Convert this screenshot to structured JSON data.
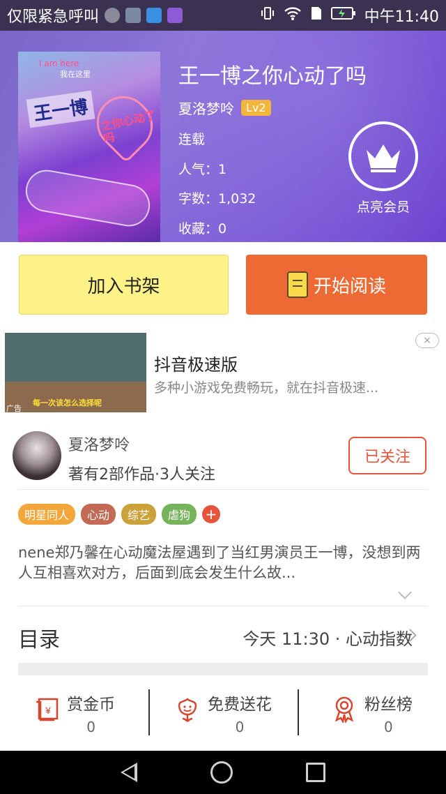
{
  "status_bar": {
    "carrier": "仅限紧急呼叫",
    "time": "中午11:40"
  },
  "book": {
    "title": "王一博之你心动了吗",
    "author": "夏洛梦呤",
    "level": "Lv2",
    "status": "连载",
    "popularity": "人气：1",
    "word_count": "字数：1,032",
    "favorites": "收藏：0",
    "vip_label": "点亮会员",
    "cover_text": {
      "tag": "I am here",
      "tag2": "我在这里",
      "title": "王一博",
      "sub": "之你心动了吗"
    }
  },
  "actions": {
    "add_shelf": "加入书架",
    "start_reading": "开始阅读"
  },
  "ad": {
    "title": "抖音极速版",
    "description": "多种小游戏免费畅玩，就在抖音极速...",
    "close": "×",
    "ad_label": "广告",
    "banner": "每一次该怎么选择呢"
  },
  "author_card": {
    "name": "夏洛梦呤",
    "stats": "著有2部作品·3人关注",
    "follow_label": "已关注"
  },
  "tags": [
    {
      "label": "明星同人",
      "color": "#f3a63a"
    },
    {
      "label": "心动",
      "color": "#c36a54"
    },
    {
      "label": "综艺",
      "color": "#caa13b"
    },
    {
      "label": "虐狗",
      "color": "#77b35c"
    }
  ],
  "tag_more": "+",
  "summary": "nene郑乃馨在心动魔法屋遇到了当红男演员王一博，没想到两人互相喜欢对方，后面到底会发生什么故...",
  "toc": {
    "label": "目录",
    "latest": "今天 11:30 · 心动指数"
  },
  "bottom_stats": [
    {
      "label": "赏金币",
      "count": "0",
      "icon": "coin-envelope-icon"
    },
    {
      "label": "免费送花",
      "count": "0",
      "icon": "flower-icon"
    },
    {
      "label": "粉丝榜",
      "count": "0",
      "icon": "medal-icon"
    }
  ],
  "colors": {
    "accent": "#ee6a35",
    "shelf_button": "#fdf287",
    "follow": "#e7543b"
  }
}
